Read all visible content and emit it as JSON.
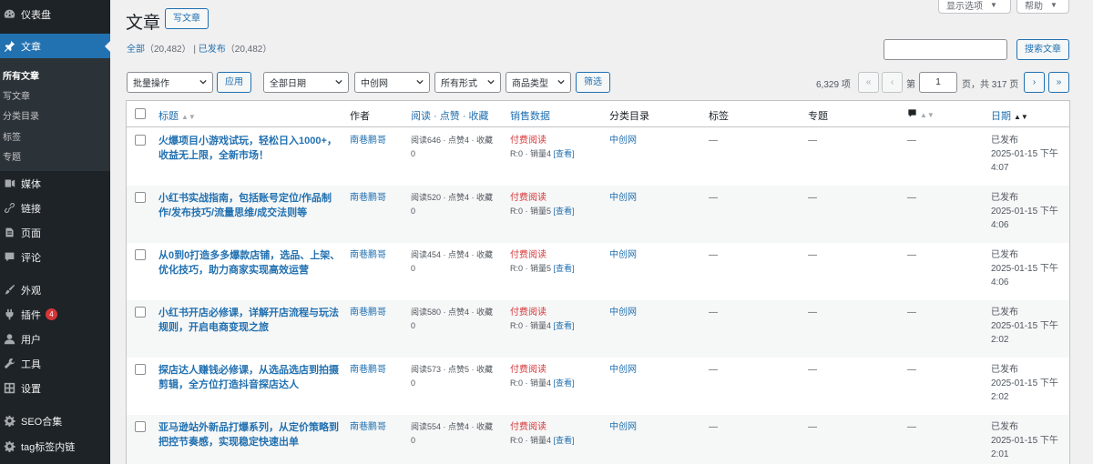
{
  "sidebar": {
    "dashboard": "仪表盘",
    "posts": "文章",
    "submenu": [
      "所有文章",
      "写文章",
      "分类目录",
      "标签",
      "专题"
    ],
    "media": "媒体",
    "links": "链接",
    "pages": "页面",
    "comments": "评论",
    "appearance": "外观",
    "plugins": "插件",
    "plugins_badge": "4",
    "users": "用户",
    "tools": "工具",
    "settings": "设置",
    "seo": "SEO合集",
    "tag_links": "tag标签内链"
  },
  "header": {
    "title": "文章",
    "add_new": "写文章",
    "screen_options": "显示选项",
    "help": "帮助"
  },
  "views": {
    "all": "全部",
    "all_count": "（20,482）",
    "separator": "|",
    "published": "已发布",
    "published_count": "（20,482）"
  },
  "search": {
    "placeholder": "",
    "button": "搜索文章"
  },
  "filters": {
    "bulk_action": "批量操作",
    "apply": "应用",
    "all_dates": "全部日期",
    "site": "中创网",
    "all_formats": "所有形式",
    "product_type": "商品类型",
    "filter": "筛选"
  },
  "pagination": {
    "items": "6,329 项",
    "first": "«",
    "prev": "‹",
    "page_label": "第",
    "current_page": "1",
    "total": "页，共 317 页",
    "next": "›",
    "last": "»"
  },
  "table": {
    "columns": {
      "title": "标题",
      "author": "作者",
      "stats": "阅读 · 点赞 · 收藏",
      "sales": "销售数据",
      "category": "分类目录",
      "tags": "标签",
      "topic": "专题",
      "date": "日期"
    },
    "rows": [
      {
        "title": "火爆项目小游戏试玩，轻松日入1000+，收益无上限，全新市场！",
        "author": "南巷鹏哥",
        "stats1": "阅读646 · 点赞4 · 收藏",
        "stats2": "0",
        "paid": "付费阅读",
        "sales": "R:0 · 销量4",
        "view": "[查看]",
        "category": "中创网",
        "tags": "—",
        "topic": "—",
        "comments": "—",
        "status": "已发布",
        "date1": "2025-01-15 下午",
        "date2": "4:07"
      },
      {
        "title": "小红书实战指南，包括账号定位/作品制作/发布技巧/流量思维/成交法则等",
        "author": "南巷鹏哥",
        "stats1": "阅读520 · 点赞4 · 收藏",
        "stats2": "0",
        "paid": "付费阅读",
        "sales": "R:0 · 销量5",
        "view": "[查看]",
        "category": "中创网",
        "tags": "—",
        "topic": "—",
        "comments": "—",
        "status": "已发布",
        "date1": "2025-01-15 下午",
        "date2": "4:06"
      },
      {
        "title": "从0到0打造多多爆款店铺，选品、上架、优化技巧，助力商家实现高效运营",
        "author": "南巷鹏哥",
        "stats1": "阅读454 · 点赞4 · 收藏",
        "stats2": "0",
        "paid": "付费阅读",
        "sales": "R:0 · 销量5",
        "view": "[查看]",
        "category": "中创网",
        "tags": "—",
        "topic": "—",
        "comments": "—",
        "status": "已发布",
        "date1": "2025-01-15 下午",
        "date2": "4:06"
      },
      {
        "title": "小红书开店必修课，详解开店流程与玩法规则，开启电商变现之旅",
        "author": "南巷鹏哥",
        "stats1": "阅读580 · 点赞4 · 收藏",
        "stats2": "0",
        "paid": "付费阅读",
        "sales": "R:0 · 销量4",
        "view": "[查看]",
        "category": "中创网",
        "tags": "—",
        "topic": "—",
        "comments": "—",
        "status": "已发布",
        "date1": "2025-01-15 下午",
        "date2": "2:02"
      },
      {
        "title": "探店达人赚钱必修课，从选品选店到拍摄剪辑，全方位打造抖音探店达人",
        "author": "南巷鹏哥",
        "stats1": "阅读573 · 点赞5 · 收藏",
        "stats2": "0",
        "paid": "付费阅读",
        "sales": "R:0 · 销量4",
        "view": "[查看]",
        "category": "中创网",
        "tags": "—",
        "topic": "—",
        "comments": "—",
        "status": "已发布",
        "date1": "2025-01-15 下午",
        "date2": "2:02"
      },
      {
        "title": "亚马逊站外新品打爆系列，从定价策略到把控节奏感，实现稳定快速出单",
        "author": "南巷鹏哥",
        "stats1": "阅读554 · 点赞4 · 收藏",
        "stats2": "0",
        "paid": "付费阅读",
        "sales": "R:0 · 销量4",
        "view": "[查看]",
        "category": "中创网",
        "tags": "—",
        "topic": "—",
        "comments": "—",
        "status": "已发布",
        "date1": "2025-01-15 下午",
        "date2": "2:01"
      }
    ]
  },
  "colors": {
    "sidebar_bg": "#1d2327",
    "accent": "#2271b1",
    "paid": "#d63638",
    "badge": "#d63638"
  }
}
